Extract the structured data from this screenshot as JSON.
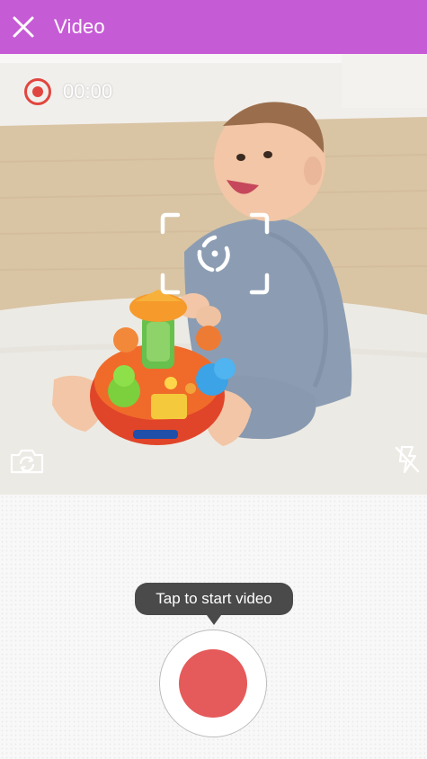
{
  "header": {
    "title": "Video",
    "close_icon": "close-icon",
    "background_color": "#c65bd6"
  },
  "preview": {
    "timer": "00:00",
    "record_indicator_icon": "record-indicator-icon",
    "focus_icon": "focus-reticle-icon",
    "switch_camera_icon": "switch-camera-icon",
    "flash_icon": "flash-off-icon",
    "record_indicator_color": "#e0463f"
  },
  "controls": {
    "tooltip": "Tap to start video",
    "record_button_icon": "record-button-icon",
    "record_color": "#e55a5a"
  }
}
